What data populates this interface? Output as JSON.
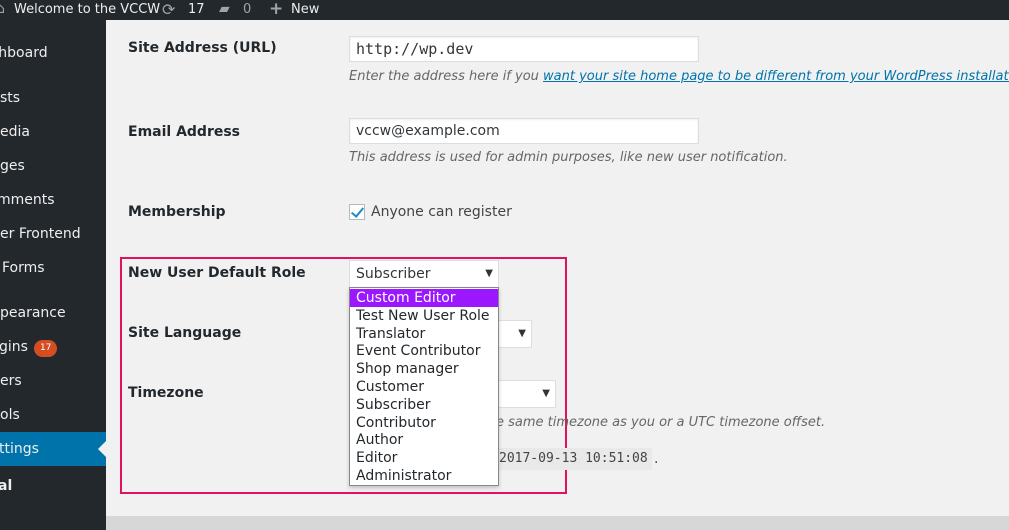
{
  "adminbar": {
    "site_name": "Welcome to the VCCW",
    "updates_count": "17",
    "comments_count": "0",
    "new_label": "New",
    "icons": {
      "home": "home-icon",
      "updates": "refresh-icon",
      "comments": "comment-icon",
      "new": "plus-icon"
    }
  },
  "sidebar": {
    "items": [
      {
        "label": "shboard"
      },
      {
        "label": "sts"
      },
      {
        "label": "edia"
      },
      {
        "label": "ges"
      },
      {
        "label": "mments"
      },
      {
        "label": "er Frontend"
      },
      {
        "label": "Forms"
      },
      {
        "label": "pearance"
      },
      {
        "label": "gins",
        "badge": "17"
      },
      {
        "label": "ers"
      },
      {
        "label": "ols"
      },
      {
        "label": "ttings",
        "current": true
      },
      {
        "label": "al"
      }
    ]
  },
  "form": {
    "site_address": {
      "label": "Site Address (URL)",
      "value": "http://wp.dev",
      "desc_prefix": "Enter the address here if you ",
      "desc_link": "want your site home page to be different from your WordPress installation dire"
    },
    "email": {
      "label": "Email Address",
      "value": "vccw@example.com",
      "desc": "This address is used for admin purposes, like new user notification."
    },
    "membership": {
      "label": "Membership",
      "checkbox_label": "Anyone can register",
      "checked": true
    },
    "default_role": {
      "label": "New User Default Role",
      "selected": "Subscriber",
      "options": [
        "Custom Editor",
        "Test New User Role",
        "Translator",
        "Event Contributor",
        "Shop manager",
        "Customer",
        "Subscriber",
        "Contributor",
        "Author",
        "Editor",
        "Administrator"
      ],
      "highlighted_option": "Custom Editor"
    },
    "site_language": {
      "label": "Site Language"
    },
    "timezone": {
      "label": "Timezone",
      "desc": "e same timezone as you or a UTC timezone offset.",
      "utc_time": "2017-09-13 10:51:08",
      "trailing": "."
    }
  },
  "colors": {
    "sidebar_bg": "#23282d",
    "current_menu": "#0073aa",
    "highlight_border": "#e0115f",
    "selected_option": "#9a17ff",
    "link": "#0073aa"
  }
}
